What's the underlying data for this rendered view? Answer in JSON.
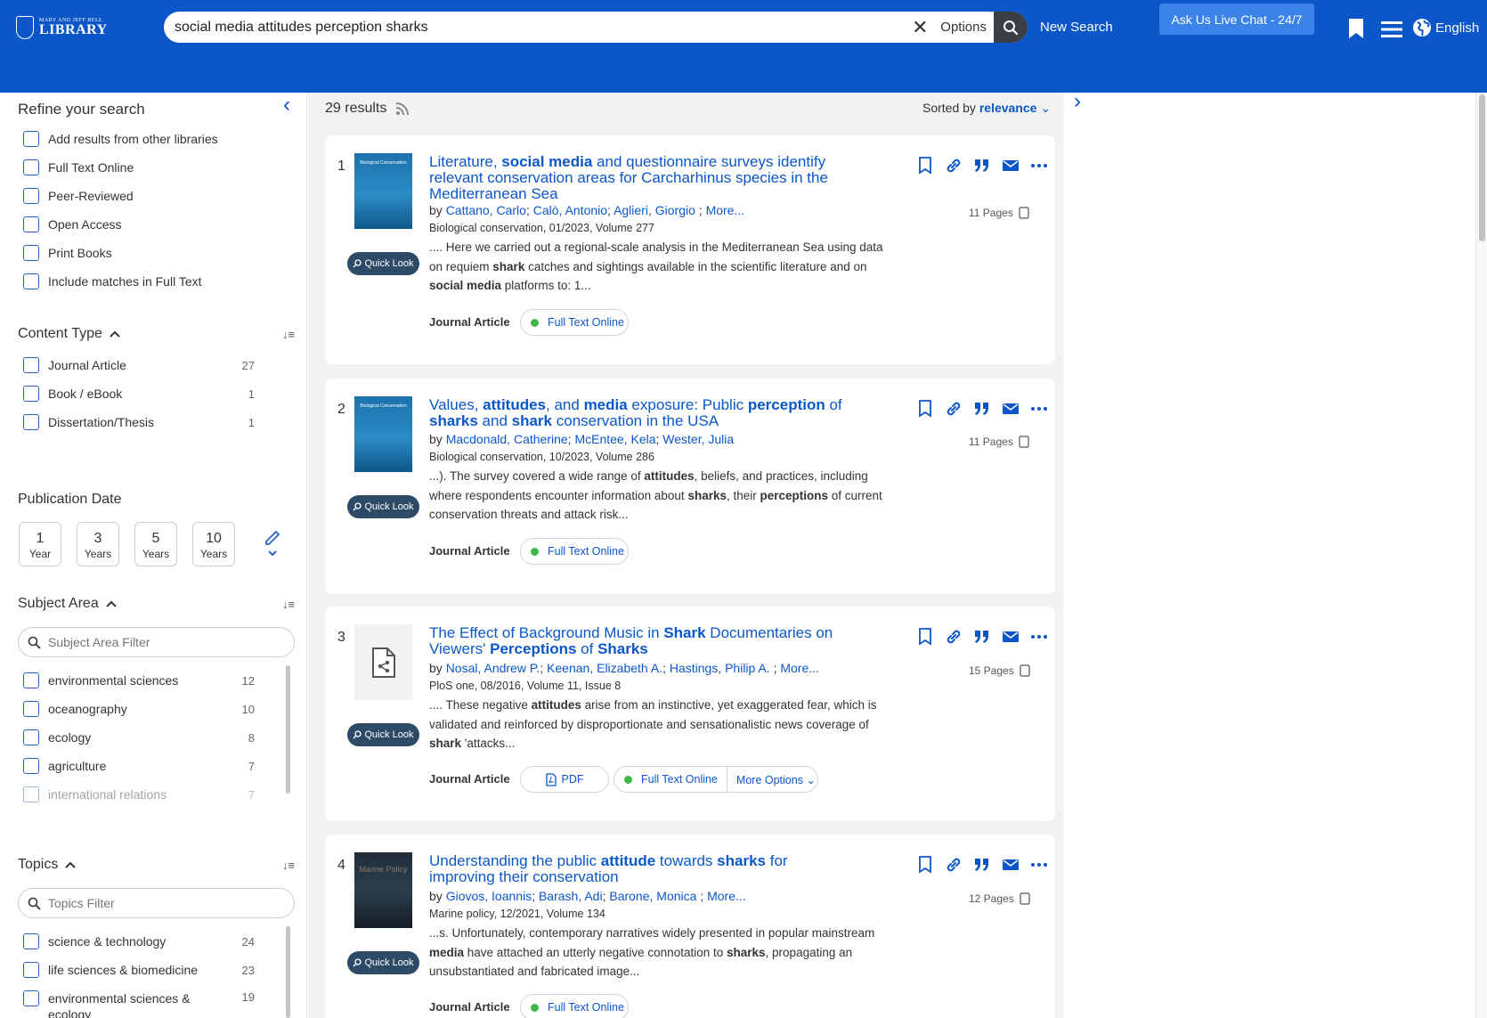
{
  "header": {
    "logo_small": "MARY AND JEFF BELL",
    "logo_big": "LIBRARY",
    "search_value": "social media attitudes perception sharks",
    "options_label": "Options",
    "new_search_label": "New Search",
    "live_chat_label": "Ask Us Live Chat - 24/7",
    "language_label": "English"
  },
  "sidebar": {
    "refine_title": "Refine your search",
    "refine_options": [
      {
        "label": "Add results from other libraries"
      },
      {
        "label": "Full Text Online"
      },
      {
        "label": "Peer-Reviewed"
      },
      {
        "label": "Open Access"
      },
      {
        "label": "Print Books"
      },
      {
        "label": "Include matches in Full Text"
      }
    ],
    "content_type_title": "Content Type",
    "content_types": [
      {
        "label": "Journal Article",
        "count": "27"
      },
      {
        "label": "Book / eBook",
        "count": "1"
      },
      {
        "label": "Dissertation/Thesis",
        "count": "1"
      }
    ],
    "pub_date_title": "Publication Date",
    "date_buttons": [
      {
        "n": "1",
        "u": "Year"
      },
      {
        "n": "3",
        "u": "Years"
      },
      {
        "n": "5",
        "u": "Years"
      },
      {
        "n": "10",
        "u": "Years"
      }
    ],
    "subject_area_title": "Subject Area",
    "subject_filter_placeholder": "Subject Area Filter",
    "subjects": [
      {
        "label": "environmental sciences",
        "count": "12"
      },
      {
        "label": "oceanography",
        "count": "10"
      },
      {
        "label": "ecology",
        "count": "8"
      },
      {
        "label": "agriculture",
        "count": "7"
      },
      {
        "label": "international relations",
        "count": "7"
      }
    ],
    "topics_title": "Topics",
    "topics_filter_placeholder": "Topics Filter",
    "topics": [
      {
        "label": "science & technology",
        "count": "24"
      },
      {
        "label": "life sciences & biomedicine",
        "count": "23"
      },
      {
        "label": "environmental sciences &",
        "count": "19"
      },
      {
        "label": "ecology",
        "count": ""
      }
    ]
  },
  "results": {
    "count_label": "29 results",
    "sorted_prefix": "Sorted by",
    "sorted_value": "relevance",
    "quick_look_label": "Quick Look",
    "items": [
      {
        "num": "1",
        "title_html": "Literature, <b>social media</b> and questionnaire surveys identify relevant conservation areas for Carcharhinus species in the Mediterranean Sea",
        "by": "by",
        "authors": [
          "Cattano, Carlo",
          "Calò, Antonio",
          "Aglieri, Giorgio"
        ],
        "more": "More...",
        "pub": "Biological conservation, 01/2023, Volume 277",
        "snippet_html": ".... Here we carried out a regional-scale analysis in the Mediterranean Sea using data on requiem <b>shark</b> catches and sightings available in the scientific literature and on <b>social media</b> platforms to: 1...",
        "type": "Journal Article",
        "pages": "11 Pages",
        "full_text": "Full Text Online",
        "cover": "Biological Conservation"
      },
      {
        "num": "2",
        "title_html": "Values, <b>attitudes</b>, and <b>media</b> exposure: Public <b>perception</b> of <b>sharks</b> and <b>shark</b> conservation in the USA",
        "by": "by",
        "authors": [
          "Macdonald, Catherine",
          "McEntee, Kela",
          "Wester, Julia"
        ],
        "more": "",
        "pub": "Biological conservation, 10/2023, Volume 286",
        "snippet_html": "...). The survey covered a wide range of <b>attitudes</b>, beliefs, and practices, including where respondents encounter information about <b>sharks</b>, their <b>perceptions</b> of current conservation threats and attack risk...",
        "type": "Journal Article",
        "pages": "11 Pages",
        "full_text": "Full Text Online",
        "cover": "Biological Conservation"
      },
      {
        "num": "3",
        "title_html": "The Effect of Background Music in <b>Shark</b> Documentaries on Viewers' <b>Perceptions</b> of <b>Sharks</b>",
        "by": "by",
        "authors": [
          "Nosal, Andrew P.",
          "Keenan, Elizabeth A.",
          "Hastings, Philip A."
        ],
        "more": "More...",
        "pub": "PloS one, 08/2016, Volume 11, Issue 8",
        "snippet_html": ".... These negative <b>attitudes</b> arise from an instinctive, yet exaggerated fear, which is validated and reinforced by disproportionate and sensationalistic news coverage of <b>shark</b> 'attacks...",
        "type": "Journal Article",
        "pages": "15 Pages",
        "pdf": "PDF",
        "full_text": "Full Text Online",
        "more_options": "More Options"
      },
      {
        "num": "4",
        "title_html": "Understanding the public <b>attitude</b> towards <b>sharks</b> for improving their conservation",
        "by": "by",
        "authors": [
          "Giovos, Ioannis",
          "Barash, Adi",
          "Barone, Monica"
        ],
        "more": "More...",
        "pub": "Marine policy, 12/2021, Volume 134",
        "snippet_html": "...s. Unfortunately, contemporary narratives widely presented in popular mainstream <b>media</b> have attached an utterly negative connotation to <b>sharks</b>, propagating an unsubstantiated and fabricated image...",
        "type": "Journal Article",
        "pages": "12 Pages",
        "full_text": "Full Text Online",
        "cover": "Marine Policy"
      }
    ]
  }
}
